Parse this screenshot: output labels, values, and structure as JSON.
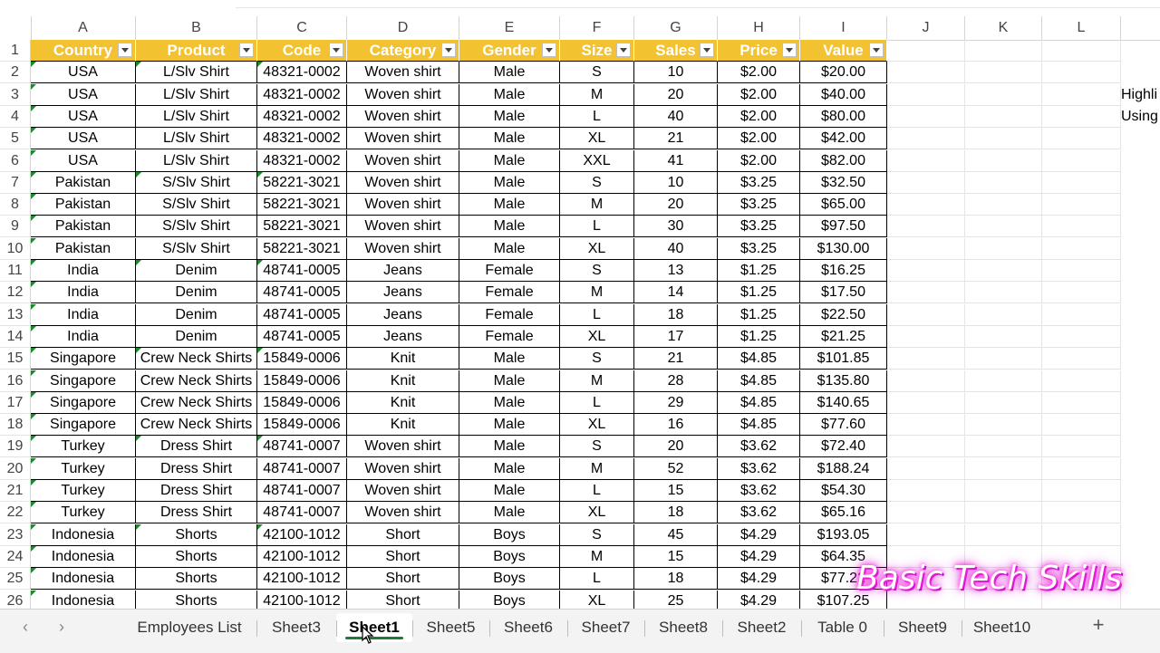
{
  "columns": [
    "A",
    "B",
    "C",
    "D",
    "E",
    "F",
    "G",
    "H",
    "I",
    "J",
    "K",
    "L"
  ],
  "headers": [
    "Country",
    "Product",
    "Code",
    "Category",
    "Gender",
    "Size",
    "Sales",
    "Price",
    "Value"
  ],
  "rows": [
    [
      "USA",
      "L/Slv Shirt",
      "48321-0002",
      "Woven shirt",
      "Male",
      "S",
      "10",
      "$2.00",
      "$20.00"
    ],
    [
      "USA",
      "L/Slv Shirt",
      "48321-0002",
      "Woven shirt",
      "Male",
      "M",
      "20",
      "$2.00",
      "$40.00"
    ],
    [
      "USA",
      "L/Slv Shirt",
      "48321-0002",
      "Woven shirt",
      "Male",
      "L",
      "40",
      "$2.00",
      "$80.00"
    ],
    [
      "USA",
      "L/Slv Shirt",
      "48321-0002",
      "Woven shirt",
      "Male",
      "XL",
      "21",
      "$2.00",
      "$42.00"
    ],
    [
      "USA",
      "L/Slv Shirt",
      "48321-0002",
      "Woven shirt",
      "Male",
      "XXL",
      "41",
      "$2.00",
      "$82.00"
    ],
    [
      "Pakistan",
      "S/Slv Shirt",
      "58221-3021",
      "Woven shirt",
      "Male",
      "S",
      "10",
      "$3.25",
      "$32.50"
    ],
    [
      "Pakistan",
      "S/Slv Shirt",
      "58221-3021",
      "Woven shirt",
      "Male",
      "M",
      "20",
      "$3.25",
      "$65.00"
    ],
    [
      "Pakistan",
      "S/Slv Shirt",
      "58221-3021",
      "Woven shirt",
      "Male",
      "L",
      "30",
      "$3.25",
      "$97.50"
    ],
    [
      "Pakistan",
      "S/Slv Shirt",
      "58221-3021",
      "Woven shirt",
      "Male",
      "XL",
      "40",
      "$3.25",
      "$130.00"
    ],
    [
      "India",
      "Denim",
      "48741-0005",
      "Jeans",
      "Female",
      "S",
      "13",
      "$1.25",
      "$16.25"
    ],
    [
      "India",
      "Denim",
      "48741-0005",
      "Jeans",
      "Female",
      "M",
      "14",
      "$1.25",
      "$17.50"
    ],
    [
      "India",
      "Denim",
      "48741-0005",
      "Jeans",
      "Female",
      "L",
      "18",
      "$1.25",
      "$22.50"
    ],
    [
      "India",
      "Denim",
      "48741-0005",
      "Jeans",
      "Female",
      "XL",
      "17",
      "$1.25",
      "$21.25"
    ],
    [
      "Singapore",
      "Crew Neck Shirts",
      "15849-0006",
      "Knit",
      "Male",
      "S",
      "21",
      "$4.85",
      "$101.85"
    ],
    [
      "Singapore",
      "Crew Neck Shirts",
      "15849-0006",
      "Knit",
      "Male",
      "M",
      "28",
      "$4.85",
      "$135.80"
    ],
    [
      "Singapore",
      "Crew Neck Shirts",
      "15849-0006",
      "Knit",
      "Male",
      "L",
      "29",
      "$4.85",
      "$140.65"
    ],
    [
      "Singapore",
      "Crew Neck Shirts",
      "15849-0006",
      "Knit",
      "Male",
      "XL",
      "16",
      "$4.85",
      "$77.60"
    ],
    [
      "Turkey",
      "Dress Shirt",
      "48741-0007",
      "Woven shirt",
      "Male",
      "S",
      "20",
      "$3.62",
      "$72.40"
    ],
    [
      "Turkey",
      "Dress Shirt",
      "48741-0007",
      "Woven shirt",
      "Male",
      "M",
      "52",
      "$3.62",
      "$188.24"
    ],
    [
      "Turkey",
      "Dress Shirt",
      "48741-0007",
      "Woven shirt",
      "Male",
      "L",
      "15",
      "$3.62",
      "$54.30"
    ],
    [
      "Turkey",
      "Dress Shirt",
      "48741-0007",
      "Woven shirt",
      "Male",
      "XL",
      "18",
      "$3.62",
      "$65.16"
    ],
    [
      "Indonesia",
      "Shorts",
      "42100-1012",
      "Short",
      "Boys",
      "S",
      "45",
      "$4.29",
      "$193.05"
    ],
    [
      "Indonesia",
      "Shorts",
      "42100-1012",
      "Short",
      "Boys",
      "M",
      "15",
      "$4.29",
      "$64.35"
    ],
    [
      "Indonesia",
      "Shorts",
      "42100-1012",
      "Short",
      "Boys",
      "L",
      "18",
      "$4.29",
      "$77.22"
    ],
    [
      "Indonesia",
      "Shorts",
      "42100-1012",
      "Short",
      "Boys",
      "XL",
      "25",
      "$4.29",
      "$107.25"
    ]
  ],
  "side_notes": [
    "Highli",
    "Using"
  ],
  "tabs": [
    "Employees List",
    "Sheet3",
    "Sheet1",
    "Sheet5",
    "Sheet6",
    "Sheet7",
    "Sheet8",
    "Sheet2",
    "Table 0",
    "Sheet9",
    "Sheet10"
  ],
  "active_tab": "Sheet1",
  "nav": {
    "prev": "‹",
    "next": "›",
    "add": "+"
  },
  "watermark": "Basic Tech Skills",
  "colors": {
    "header_fill": "#f2c230",
    "header_text": "#ffffff",
    "tab_underline": "#1e7b34",
    "error_triangle": "#1a8a2a"
  }
}
